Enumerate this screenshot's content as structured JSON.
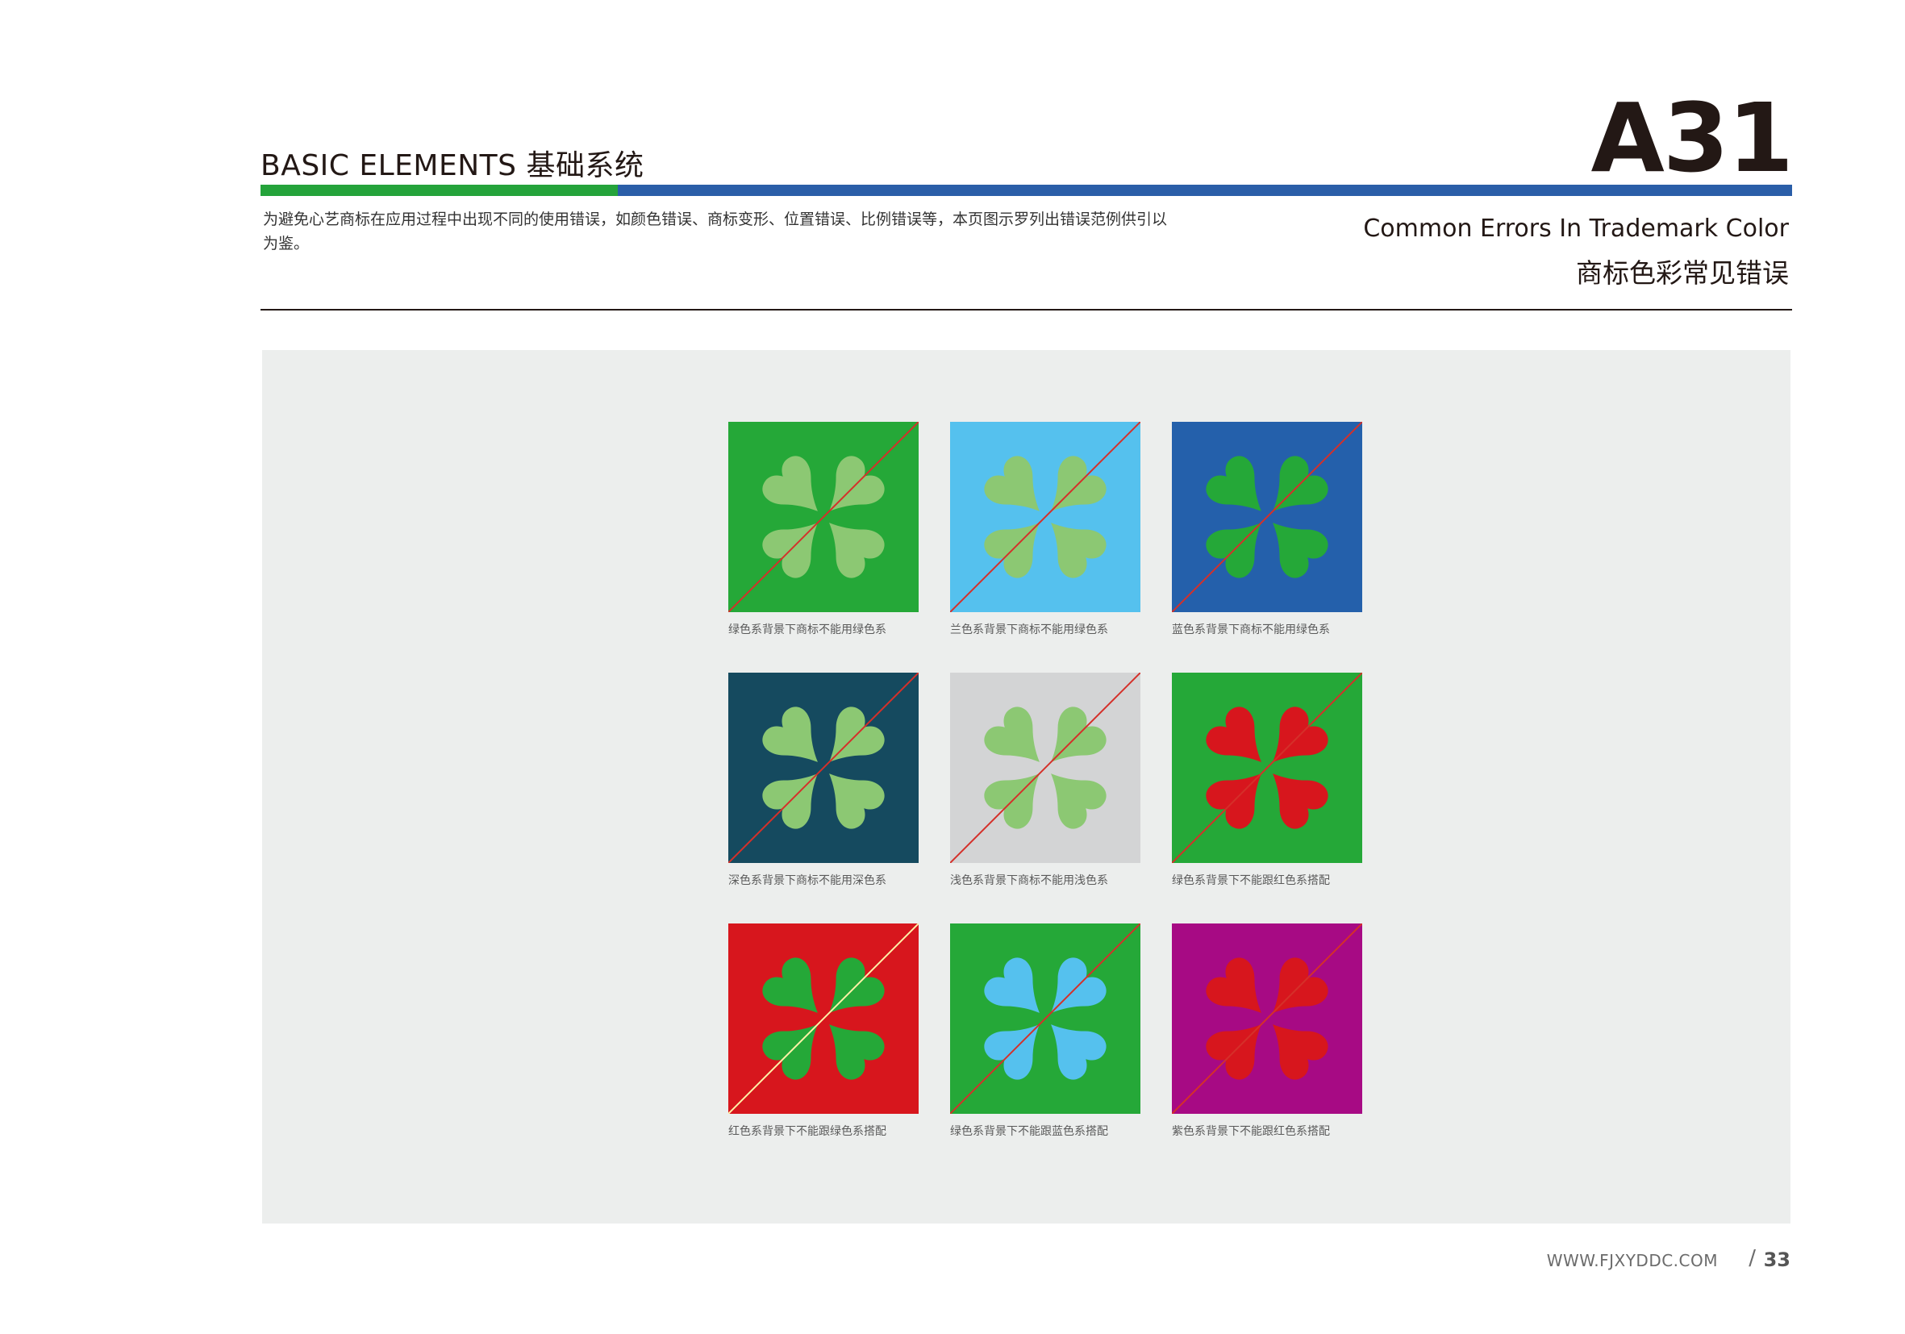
{
  "header": {
    "section_title": "BASIC ELEMENTS 基础系统",
    "page_code": "A31",
    "intro": "为避免心艺商标在应用过程中出现不同的使用错误，如颜色错误、商标变形、位置错误、比例错误等，本页图示罗列出错误范例供引以为鉴。",
    "title_en": "Common Errors  In Trademark Color",
    "title_cn": "商标色彩常见错误"
  },
  "colors": {
    "green_bar": "#24a33a",
    "blue_bar": "#2a5ea8",
    "panel": "#eceeed"
  },
  "examples": [
    {
      "caption": "绿色系背景下商标不能用绿色系",
      "bg": "#25a838",
      "logo": "#8cc873",
      "slash": "#d5302a"
    },
    {
      "caption": "兰色系背景下商标不能用绿色系",
      "bg": "#55c1ee",
      "logo": "#8cc873",
      "slash": "#d5302a"
    },
    {
      "caption": "蓝色系背景下商标不能用绿色系",
      "bg": "#2460ab",
      "logo": "#25a838",
      "slash": "#d5302a"
    },
    {
      "caption": "深色系背景下商标不能用深色系",
      "bg": "#154a5f",
      "logo": "#8cc873",
      "slash": "#d5302a"
    },
    {
      "caption": "浅色系背景下商标不能用浅色系",
      "bg": "#d3d4d5",
      "logo": "#8cc873",
      "slash": "#d5302a"
    },
    {
      "caption": "绿色系背景下不能跟红色系搭配",
      "bg": "#25a838",
      "logo": "#d7161d",
      "slash": "#d5302a"
    },
    {
      "caption": "红色系背景下不能跟绿色系搭配",
      "bg": "#d7161d",
      "logo": "#25a838",
      "slash": "#fff2a8"
    },
    {
      "caption": "绿色系背景下不能跟蓝色系搭配",
      "bg": "#25a838",
      "logo": "#55c1ee",
      "slash": "#d5302a"
    },
    {
      "caption": "紫色系背景下不能跟红色系搭配",
      "bg": "#a70a84",
      "logo": "#d7161d",
      "slash": "#d5302a"
    }
  ],
  "footer": {
    "url": "WWW.FJXYDDC.COM",
    "slash": "/",
    "page_number": "33"
  }
}
